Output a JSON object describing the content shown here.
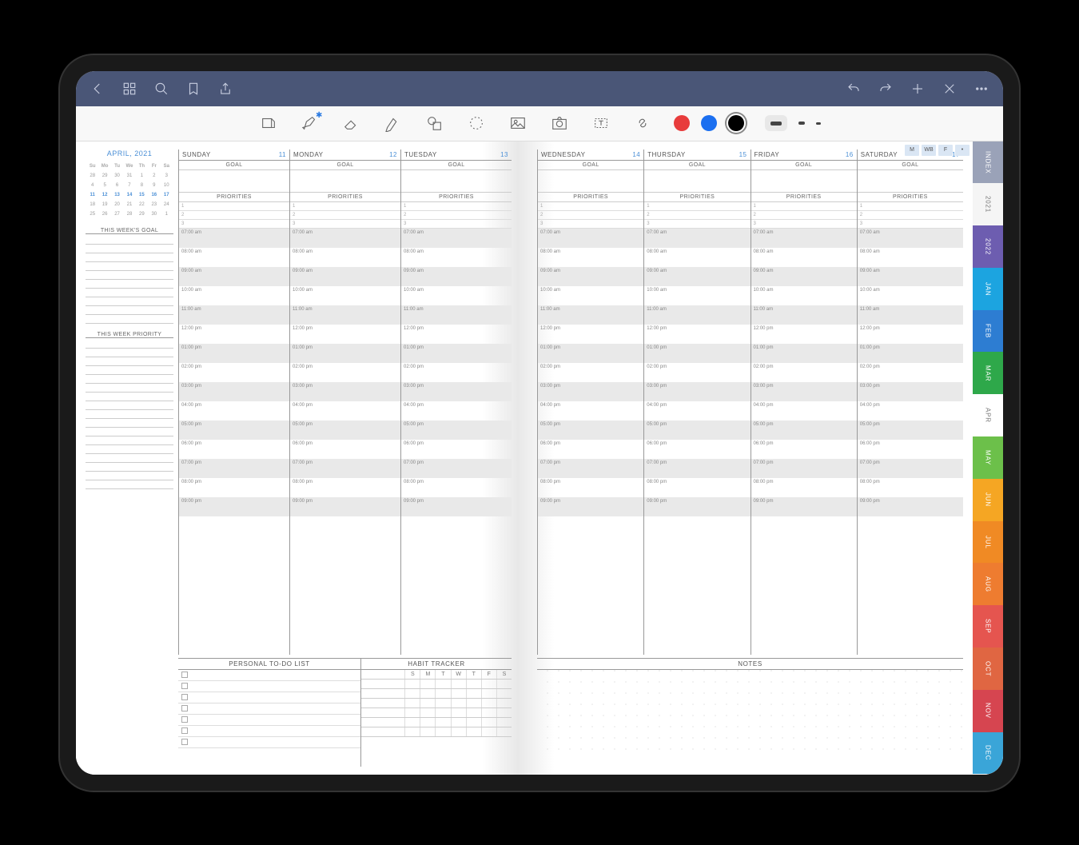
{
  "topbar": {},
  "toolbar": {
    "colors": [
      {
        "hex": "#e83c3c",
        "sel": false
      },
      {
        "hex": "#1b6ff0",
        "sel": false
      },
      {
        "hex": "#000",
        "sel": true
      }
    ],
    "strokes": [
      {
        "hex": "#444",
        "w": 14,
        "sel": true
      },
      {
        "hex": "#444",
        "w": 8,
        "sel": false
      },
      {
        "hex": "#444",
        "w": 6,
        "sel": false
      }
    ]
  },
  "viewbtns": [
    "M",
    "WB",
    "F",
    "•"
  ],
  "calendar": {
    "month_label": "APRIL, 2021",
    "dow": [
      "Su",
      "Mo",
      "Tu",
      "We",
      "Th",
      "Fr",
      "Sa"
    ],
    "rows": [
      [
        {
          "n": "28"
        },
        {
          "n": "29"
        },
        {
          "n": "30"
        },
        {
          "n": "31"
        },
        {
          "n": "1"
        },
        {
          "n": "2"
        },
        {
          "n": "3"
        }
      ],
      [
        {
          "n": "4"
        },
        {
          "n": "5"
        },
        {
          "n": "6"
        },
        {
          "n": "7"
        },
        {
          "n": "8"
        },
        {
          "n": "9"
        },
        {
          "n": "10"
        }
      ],
      [
        {
          "n": "11",
          "c": 1
        },
        {
          "n": "12",
          "c": 1
        },
        {
          "n": "13",
          "c": 1
        },
        {
          "n": "14",
          "c": 1
        },
        {
          "n": "15",
          "c": 1
        },
        {
          "n": "16",
          "c": 1
        },
        {
          "n": "17",
          "c": 1
        }
      ],
      [
        {
          "n": "18"
        },
        {
          "n": "19"
        },
        {
          "n": "20"
        },
        {
          "n": "21"
        },
        {
          "n": "22"
        },
        {
          "n": "23"
        },
        {
          "n": "24"
        }
      ],
      [
        {
          "n": "25"
        },
        {
          "n": "26"
        },
        {
          "n": "27"
        },
        {
          "n": "28"
        },
        {
          "n": "29"
        },
        {
          "n": "30"
        },
        {
          "n": "1"
        }
      ]
    ]
  },
  "side": {
    "goal": "THIS WEEK'S GOAL",
    "priority": "THIS WEEK PRIORITY"
  },
  "days_left": [
    {
      "name": "SUNDAY",
      "num": "11"
    },
    {
      "name": "MONDAY",
      "num": "12"
    },
    {
      "name": "TUESDAY",
      "num": "13"
    }
  ],
  "days_right": [
    {
      "name": "WEDNESDAY",
      "num": "14"
    },
    {
      "name": "THURSDAY",
      "num": "15"
    },
    {
      "name": "FRIDAY",
      "num": "16"
    },
    {
      "name": "SATURDAY",
      "num": "17"
    }
  ],
  "labels": {
    "goal": "GOAL",
    "priorities": "PRIORITIES",
    "todo": "PERSONAL TO-DO LIST",
    "habit": "HABIT TRACKER",
    "notes": "NOTES"
  },
  "priorities": [
    "1",
    "2",
    "3"
  ],
  "times": [
    "07:00 am",
    "08:00 am",
    "09:00 am",
    "10:00 am",
    "11:00 am",
    "12:00 pm",
    "01:00 pm",
    "02:00 pm",
    "03:00 pm",
    "04:00 pm",
    "05:00 pm",
    "06:00 pm",
    "07:00 pm",
    "08:00 pm",
    "09:00 pm"
  ],
  "habit_days": [
    "S",
    "M",
    "T",
    "W",
    "T",
    "F",
    "S"
  ],
  "tabs": [
    {
      "label": "INDEX",
      "color": "#9aa2b8"
    },
    {
      "label": "2021",
      "color": "#f5f5f5",
      "light": true
    },
    {
      "label": "2022",
      "color": "#6d5db0"
    },
    {
      "label": "JAN",
      "color": "#1ca4e0"
    },
    {
      "label": "FEB",
      "color": "#2d7dd2"
    },
    {
      "label": "MAR",
      "color": "#2ea84a"
    },
    {
      "label": "APR",
      "color": "#ffffff",
      "light": true
    },
    {
      "label": "MAY",
      "color": "#6cc04a"
    },
    {
      "label": "JUN",
      "color": "#f5a623"
    },
    {
      "label": "JUL",
      "color": "#f08a24"
    },
    {
      "label": "AUG",
      "color": "#ee7c30"
    },
    {
      "label": "SEP",
      "color": "#e5554f"
    },
    {
      "label": "OCT",
      "color": "#e06642"
    },
    {
      "label": "NOV",
      "color": "#d64550"
    },
    {
      "label": "DEC",
      "color": "#3aa5d8"
    }
  ]
}
